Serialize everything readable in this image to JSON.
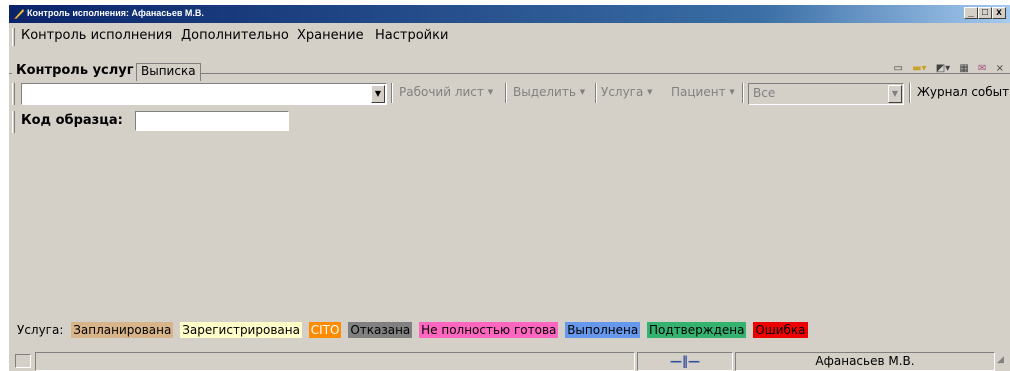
{
  "window": {
    "title": "Контроль исполнения: Афанасьев М.В.",
    "buttons": {
      "minimize": "_",
      "maximize": "□",
      "close": "x"
    }
  },
  "menu": [
    "Контроль исполнения",
    "Дополнительно",
    "Хранение",
    "Настройки"
  ],
  "tabs": [
    {
      "label": "Контроль услуг",
      "active": true
    },
    {
      "label": "Выписка",
      "active": false
    }
  ],
  "top_icons": [
    "document-icon",
    "folder-icon",
    "open-icon",
    "grid-icon",
    "mail-icon",
    "close-icon"
  ],
  "toolbar": {
    "main_combo_value": "",
    "work_sheet": "Рабочий лист",
    "select": "Выделить",
    "service": "Услуга",
    "patient": "Пациент",
    "filter_value": "Все",
    "event_log": "Журнал событ"
  },
  "sample": {
    "label": "Код образца:",
    "value": ""
  },
  "legend": {
    "label": "Услуга:",
    "items": [
      {
        "label": "Запланирована",
        "color": "#d8b48a",
        "text_color": "#000000"
      },
      {
        "label": "Зарегистрирована",
        "color": "#fffdc8",
        "text_color": "#000000"
      },
      {
        "label": "CITO",
        "color": "#ff8c00",
        "text_color": "#ffffff"
      },
      {
        "label": "Отказана",
        "color": "#808080",
        "text_color": "#000000"
      },
      {
        "label": "Не полностью готова",
        "color": "#ff66c0",
        "text_color": "#000000"
      },
      {
        "label": "Выполнена",
        "color": "#6699ee",
        "text_color": "#000000"
      },
      {
        "label": "Подтверждена",
        "color": "#33b270",
        "text_color": "#000000"
      },
      {
        "label": "Ошибка",
        "color": "#ee0000",
        "text_color": "#000000"
      }
    ]
  },
  "status": {
    "connection_icon": "plug-icon",
    "user": "Афанасьев М.В."
  }
}
